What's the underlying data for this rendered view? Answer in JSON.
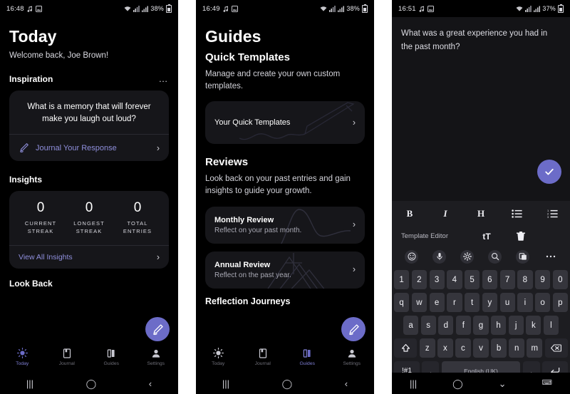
{
  "panels": [
    {
      "status": {
        "time": "16:48",
        "battery": "38%",
        "icons": [
          "music-note-icon",
          "image-icon",
          "wifi-icon",
          "signal-alt-icon",
          "signal-icon",
          "battery-icon"
        ]
      },
      "title": "Today",
      "welcome": "Welcome back, Joe Brown!",
      "inspiration": {
        "heading": "Inspiration",
        "overflow": "…",
        "question": "What is a memory that will forever make you laugh out loud?",
        "cta": "Journal Your Response",
        "chevron": "›"
      },
      "insights": {
        "heading": "Insights",
        "stats": [
          {
            "value": "0",
            "label": "CURRENT STREAK"
          },
          {
            "value": "0",
            "label": "LONGEST STREAK"
          },
          {
            "value": "0",
            "label": "TOTAL ENTRIES"
          }
        ],
        "cta": "View All Insights",
        "chevron": "›"
      },
      "look_back": "Look Back",
      "fab": "compose-pencil",
      "nav": [
        {
          "label": "Today",
          "icon": "sun-icon",
          "active": true
        },
        {
          "label": "Journal",
          "icon": "book-icon",
          "active": false
        },
        {
          "label": "Guides",
          "icon": "map-icon",
          "active": false
        },
        {
          "label": "Settings",
          "icon": "person-icon",
          "active": false
        }
      ],
      "sysnav": [
        "recents-icon",
        "home-icon",
        "back-icon"
      ]
    },
    {
      "status": {
        "time": "16:49",
        "battery": "38%"
      },
      "title": "Guides",
      "quick_templates": {
        "heading": "Quick Templates",
        "description": "Manage and create your own custom templates.",
        "card_label": "Your Quick Templates",
        "chevron": "›"
      },
      "reviews": {
        "heading": "Reviews",
        "description": "Look back on your past entries and gain insights to guide your growth.",
        "items": [
          {
            "title": "Monthly Review",
            "subtitle": "Reflect on your past month.",
            "chevron": "›"
          },
          {
            "title": "Annual Review",
            "subtitle": "Reflect on the past year.",
            "chevron": "›"
          }
        ]
      },
      "reflection_journeys": "Reflection Journeys",
      "fab": "compose-pencil",
      "nav": [
        {
          "label": "Today",
          "icon": "sun-icon",
          "active": false
        },
        {
          "label": "Journal",
          "icon": "book-icon",
          "active": false
        },
        {
          "label": "Guides",
          "icon": "map-icon",
          "active": true
        },
        {
          "label": "Settings",
          "icon": "person-icon",
          "active": false
        }
      ]
    },
    {
      "status": {
        "time": "16:51",
        "battery": "37%"
      },
      "prompt": "What was a great experience you had in the past month?",
      "confirm": "check-icon",
      "format_bar": [
        {
          "name": "bold",
          "glyph": "B"
        },
        {
          "name": "italic",
          "glyph": "I"
        },
        {
          "name": "heading",
          "glyph": "H"
        },
        {
          "name": "bullet-list",
          "glyph": "list"
        },
        {
          "name": "numbered-list",
          "glyph": "numlist"
        }
      ],
      "template_bar": {
        "label": "Template Editor",
        "text_size": "tT",
        "delete": "trash-icon"
      },
      "keyboard_toolbar": [
        "emoji-icon",
        "microphone-icon",
        "settings-gear-icon",
        "search-icon",
        "clipboard-icon",
        "more-icon"
      ],
      "keyboard": {
        "row_numbers": [
          "1",
          "2",
          "3",
          "4",
          "5",
          "6",
          "7",
          "8",
          "9",
          "0"
        ],
        "row_top": [
          "q",
          "w",
          "e",
          "r",
          "t",
          "y",
          "u",
          "i",
          "o",
          "p"
        ],
        "row_home": [
          "a",
          "s",
          "d",
          "f",
          "g",
          "h",
          "j",
          "k",
          "l"
        ],
        "row_bottom": [
          "z",
          "x",
          "c",
          "v",
          "b",
          "n",
          "m"
        ],
        "shift": "shift-icon",
        "backspace": "backspace-icon",
        "symbols": "!#1",
        "comma": ",",
        "space": "English (UK)",
        "period": ".",
        "enter": "enter-icon"
      },
      "sysnav": [
        "recents-icon",
        "home-icon",
        "hide-keyboard-icon",
        "keyboard-icon"
      ]
    }
  ],
  "colors": {
    "accent": "#6c6cc8",
    "accent_text": "#8f8fdc",
    "card": "#16161a",
    "background": "#000000",
    "keyboard_bg": "#1d1d21",
    "key": "#35353c"
  }
}
